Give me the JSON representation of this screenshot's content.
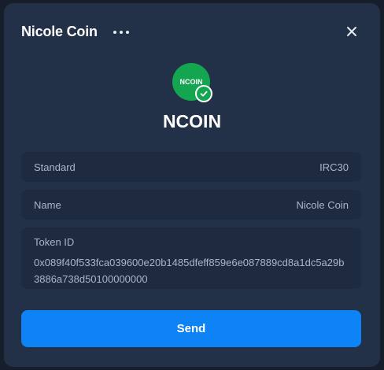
{
  "header": {
    "title": "Nicole Coin",
    "more_icon": "more-horizontal-icon",
    "close_icon": "close-icon"
  },
  "token": {
    "logo_text": "NCOIN",
    "logo_color": "#14a551",
    "verified_icon": "check-icon",
    "symbol": "NCOIN"
  },
  "details": {
    "standard": {
      "label": "Standard",
      "value": "IRC30"
    },
    "name": {
      "label": "Name",
      "value": "Nicole Coin"
    },
    "token_id": {
      "label": "Token ID",
      "value": "0x089f40f533fca039600e20b1485dfeff859e6e087889cd8a1dc5a29b3886a738d50100000000"
    }
  },
  "actions": {
    "send_label": "Send",
    "send_color": "#0d83f5"
  }
}
